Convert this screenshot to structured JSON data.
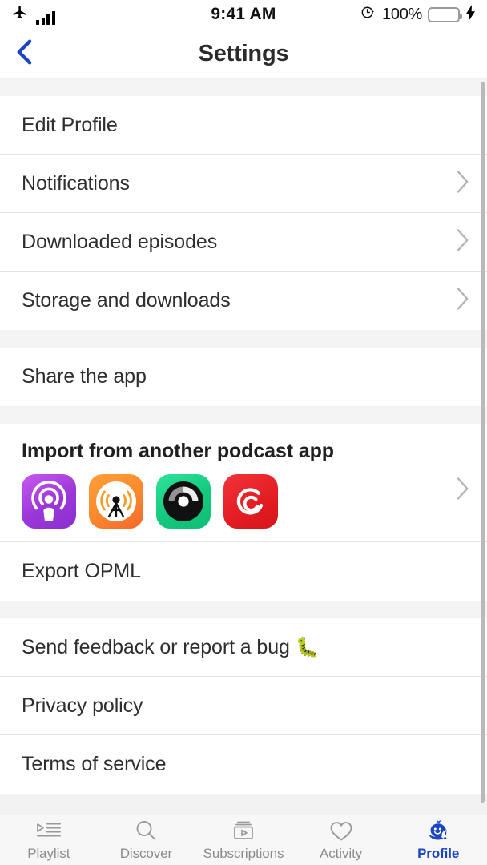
{
  "statusbar": {
    "airplane_icon": "airplane-mode-icon",
    "signal_icon": "signal-bars-icon",
    "time": "9:41 AM",
    "rotation_lock_icon": "rotation-lock-icon",
    "battery_percent": "100%",
    "battery_icon": "battery-full-icon",
    "charging_icon": "charging-bolt-icon",
    "battery_color": "#35d04b"
  },
  "navbar": {
    "back_icon": "back-chevron-icon",
    "title": "Settings",
    "accent_color": "#1b46c2"
  },
  "sections": [
    {
      "rows": [
        {
          "label": "Edit Profile",
          "chevron": false
        },
        {
          "label": "Notifications",
          "chevron": true
        },
        {
          "label": "Downloaded episodes",
          "chevron": true
        },
        {
          "label": "Storage and downloads",
          "chevron": true
        }
      ]
    },
    {
      "rows": [
        {
          "label": "Share the app",
          "chevron": false
        }
      ]
    },
    {
      "import": {
        "title": "Import from another podcast app",
        "chevron": true,
        "apps": [
          {
            "name": "apple-podcasts-icon",
            "color": "#9b37d8"
          },
          {
            "name": "overcast-icon",
            "color": "#fb8b2e"
          },
          {
            "name": "pocket-casts-icon",
            "color": "#14c97f"
          },
          {
            "name": "castro-icon",
            "color": "#e41e24"
          }
        ]
      },
      "rows": [
        {
          "label": "Export OPML",
          "chevron": false
        }
      ]
    },
    {
      "rows": [
        {
          "label": "Send feedback or report a bug",
          "emoji": "🐛",
          "chevron": false
        },
        {
          "label": "Privacy policy",
          "chevron": false
        },
        {
          "label": "Terms of service",
          "chevron": false
        }
      ]
    }
  ],
  "tabbar": {
    "tabs": [
      {
        "label": "Playlist",
        "icon": "playlist-icon",
        "active": false
      },
      {
        "label": "Discover",
        "icon": "search-icon",
        "active": false
      },
      {
        "label": "Subscriptions",
        "icon": "subscriptions-box-icon",
        "active": false
      },
      {
        "label": "Activity",
        "icon": "heart-icon",
        "active": false
      },
      {
        "label": "Profile",
        "icon": "whale-profile-icon",
        "active": true
      }
    ],
    "active_color": "#1b46c2",
    "inactive_color": "#8b8b8b"
  }
}
